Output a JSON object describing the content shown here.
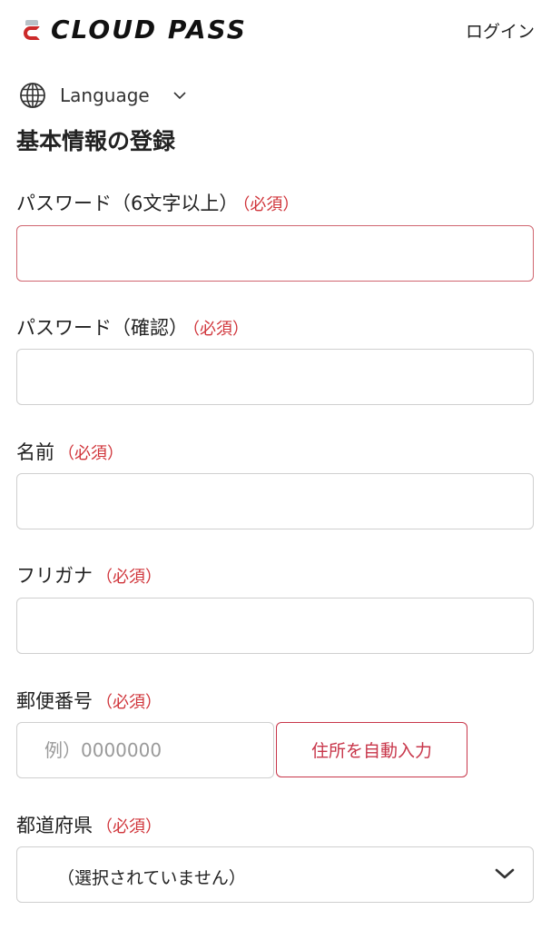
{
  "header": {
    "logo_text": "CLOUD PASS",
    "login_label": "ログイン"
  },
  "language": {
    "label": "Language",
    "icon": "globe-icon"
  },
  "page_title": "基本情報の登録",
  "required_text": "（必須）",
  "fields": {
    "password": {
      "label": "パスワード（6文字以上）",
      "value": ""
    },
    "password_confirm": {
      "label": "パスワード（確認）",
      "value": ""
    },
    "name": {
      "label": "名前",
      "value": ""
    },
    "furigana": {
      "label": "フリガナ",
      "value": ""
    },
    "postal_code": {
      "label": "郵便番号",
      "placeholder": "例）0000000",
      "value": ""
    },
    "prefecture": {
      "label": "都道府県",
      "selected": "（選択されていません）"
    }
  },
  "autofill_button": "住所を自動入力",
  "colors": {
    "required": "#d0343a",
    "brand_red": "#c8364a",
    "error_border": "#d06670"
  }
}
